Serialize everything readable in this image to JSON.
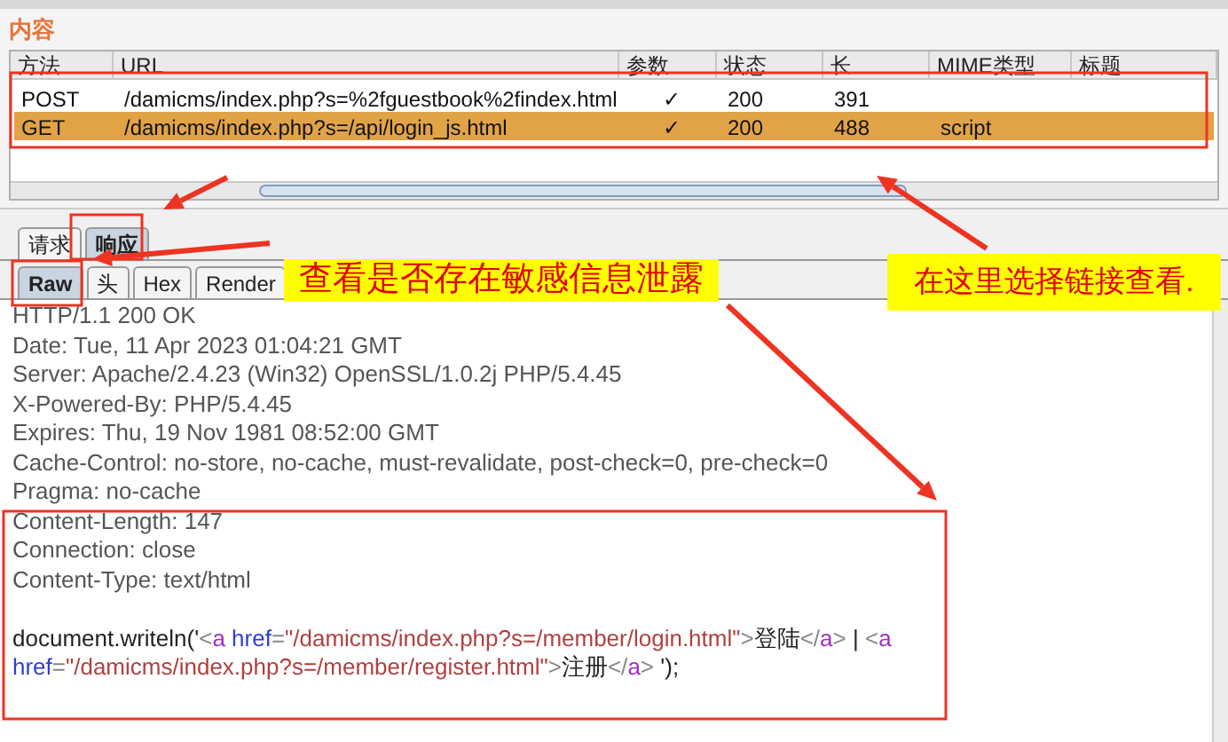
{
  "section_title": "内容",
  "table": {
    "columns": [
      "方法",
      "URL",
      "参数",
      "状态",
      "长",
      "MIME类型",
      "标题"
    ],
    "rows": [
      {
        "method": "POST",
        "url": "/damicms/index.php?s=%2fguestbook%2findex.html",
        "params": "✓",
        "status": "200",
        "length": "391",
        "selected": false
      },
      {
        "method": "GET",
        "url": "/damicms/index.php?s=/api/login_js.html",
        "params": "✓",
        "status": "200",
        "length": "488",
        "mime": "script",
        "selected": true
      }
    ]
  },
  "message_tabs": [
    {
      "label": "请求",
      "selected": false
    },
    {
      "label": "响应",
      "selected": true
    }
  ],
  "view_tabs": [
    {
      "label": "Raw",
      "selected": true
    },
    {
      "label": "头",
      "selected": false
    },
    {
      "label": "Hex",
      "selected": false
    },
    {
      "label": "Render",
      "selected": false
    }
  ],
  "response": {
    "headers": [
      "HTTP/1.1 200 OK",
      "Date: Tue, 11 Apr 2023 01:04:21 GMT",
      "Server: Apache/2.4.23 (Win32) OpenSSL/1.0.2j PHP/5.4.45",
      "X-Powered-By: PHP/5.4.45",
      "Expires: Thu, 19 Nov 1981 08:52:00 GMT",
      "Cache-Control: no-store, no-cache, must-revalidate, post-check=0, pre-check=0",
      "Pragma: no-cache",
      "Content-Length: 147",
      "Connection: close",
      "Content-Type: text/html"
    ],
    "body": [
      [
        {
          "kind": "text",
          "text": "document.writeln('"
        },
        {
          "kind": "punct",
          "text": "<"
        },
        {
          "kind": "tag",
          "text": "a"
        },
        {
          "kind": "attr",
          "text": " href"
        },
        {
          "kind": "punct",
          "text": "="
        },
        {
          "kind": "string",
          "text": "\"/damicms/index.php?s=/member/login.html\""
        },
        {
          "kind": "punct",
          "text": ">"
        },
        {
          "kind": "text",
          "text": "登陆"
        },
        {
          "kind": "punct",
          "text": "</"
        },
        {
          "kind": "tag",
          "text": "a"
        },
        {
          "kind": "punct",
          "text": ">"
        },
        {
          "kind": "text",
          "text": " | "
        },
        {
          "kind": "punct",
          "text": "<"
        },
        {
          "kind": "tag",
          "text": "a"
        }
      ],
      [
        {
          "kind": "attr",
          "text": "href"
        },
        {
          "kind": "punct",
          "text": "="
        },
        {
          "kind": "string",
          "text": "\"/damicms/index.php?s=/member/register.html\""
        },
        {
          "kind": "punct",
          "text": ">"
        },
        {
          "kind": "text",
          "text": "注册"
        },
        {
          "kind": "punct",
          "text": "</"
        },
        {
          "kind": "tag",
          "text": "a"
        },
        {
          "kind": "punct",
          "text": ">"
        },
        {
          "kind": "text",
          "text": " ');"
        }
      ]
    ]
  },
  "annotations": [
    {
      "text": "查看是否存在敏感信息泄露"
    },
    {
      "text": "在这里选择链接查看."
    }
  ]
}
